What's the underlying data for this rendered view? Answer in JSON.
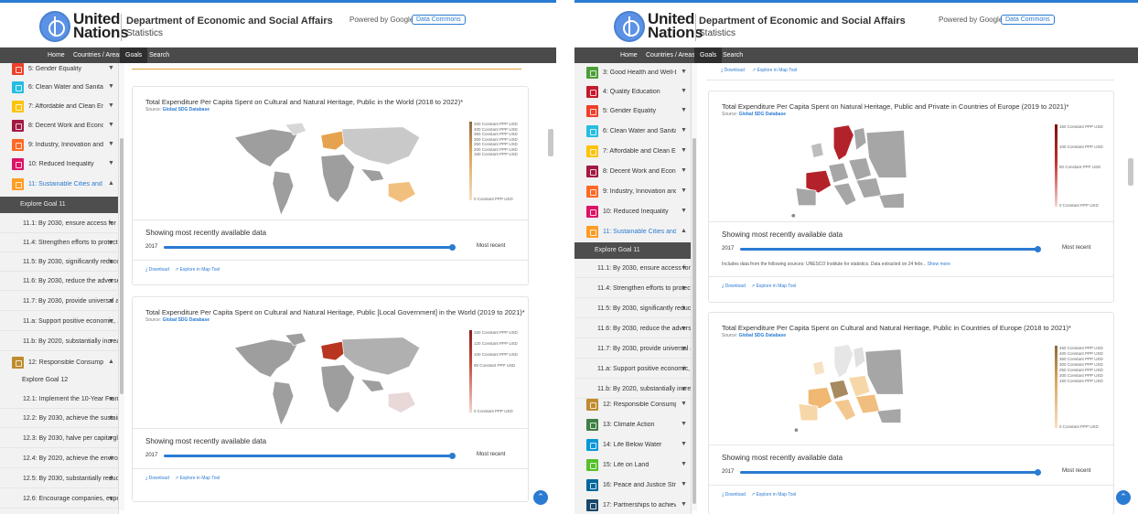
{
  "header": {
    "org_line1": "United",
    "org_line2": "Nations",
    "dept": "Department of Economic and Social Affairs",
    "subtitle": "Statistics",
    "powered": "Powered by Google's",
    "badge": "Data Commons"
  },
  "nav": {
    "home": "Home",
    "countries": "Countries / Areas",
    "goals": "Goals",
    "search": "Search"
  },
  "colors": {
    "accent": "#2a7bd2",
    "nav": "#4a4a4a",
    "map_high": "#b8361f",
    "map_low": "#f5e0c8"
  },
  "left": {
    "sidebar": {
      "goals": [
        {
          "label": "5: Gender Equality",
          "color": "#ef402b"
        },
        {
          "label": "6: Clean Water and Sanitation",
          "color": "#26bde2"
        },
        {
          "label": "7: Affordable and Clean Energy",
          "color": "#fcc30b"
        },
        {
          "label": "8: Decent Work and Economic ...",
          "color": "#a21942"
        },
        {
          "label": "9: Industry, Innovation and Infra...",
          "color": "#fd6925"
        },
        {
          "label": "10: Reduced Inequality",
          "color": "#dd1367"
        },
        {
          "label": "11: Sustainable Cities and Com...",
          "color": "#fd9d24"
        }
      ],
      "explore11": "Explore Goal 11",
      "targets11": [
        "11.1: By 2030, ensure access for a...",
        "11.4: Strengthen efforts to protect...",
        "11.5: By 2030, significantly reduce...",
        "11.6: By 2030, reduce the adverse...",
        "11.7: By 2030, provide universal a...",
        "11.a: Support positive economic, ...",
        "11.b: By 2020, substantially increa..."
      ],
      "goal12": {
        "label": "12: Responsible Consumption ...",
        "color": "#bf8b2e"
      },
      "explore12": "Explore Goal 12",
      "targets12": [
        "12.1: Implement the 10-Year Fram...",
        "12.2: By 2030, achieve the sustain...",
        "12.3: By 2030, halve per capita glo...",
        "12.4: By 2020, achieve the environ...",
        "12.5: By 2030, substantially reduc...",
        "12.6: Encourage companies, espe..."
      ]
    },
    "cards": [
      {
        "title": "Total Expenditure Per Capita Spent on Cultural and Natural Heritage, Public in the World (2018 to 2022)*",
        "source_label": "Source:",
        "source_link": "Global SDG Database",
        "legend": [
          "450 Constant PPP USD",
          "400 Constant PPP USD",
          "350 Constant PPP USD",
          "300 Constant PPP USD",
          "250 Constant PPP USD",
          "200 Constant PPP USD",
          "150 Constant PPP USD",
          "0 Constant PPP USD"
        ],
        "showing": "Showing most recently available data",
        "year": "2017",
        "recent": "Most recent",
        "download": "Download",
        "explore": "Explore in Map Tool"
      },
      {
        "title": "Total Expenditure Per Capita Spent on Cultural and Natural Heritage, Public [Local Government] in the World (2019 to 2021)*",
        "source_label": "Source:",
        "source_link": "Global SDG Database",
        "legend": [
          "150 Constant PPP USD",
          "120 Constant PPP USD",
          "100 Constant PPP USD",
          "80 Constant PPP USD",
          "0 Constant PPP USD"
        ],
        "showing": "Showing most recently available data",
        "year": "2017",
        "recent": "Most recent",
        "download": "Download",
        "explore": "Explore in Map Tool"
      }
    ]
  },
  "right": {
    "sidebar": {
      "goals_top": [
        {
          "label": "3: Good Health and Well-being",
          "color": "#4c9f38"
        },
        {
          "label": "4: Quality Education",
          "color": "#c5192d"
        },
        {
          "label": "5: Gender Equality",
          "color": "#ef402b"
        },
        {
          "label": "6: Clean Water and Sanitation",
          "color": "#26bde2"
        },
        {
          "label": "7: Affordable and Clean Energy",
          "color": "#fcc30b"
        },
        {
          "label": "8: Decent Work and Economic ...",
          "color": "#a21942"
        },
        {
          "label": "9: Industry, Innovation and Infra...",
          "color": "#fd6925"
        },
        {
          "label": "10: Reduced Inequality",
          "color": "#dd1367"
        },
        {
          "label": "11: Sustainable Cities and Com...",
          "color": "#fd9d24"
        }
      ],
      "explore11": "Explore Goal 11",
      "targets11": [
        "11.1: By 2030, ensure access for a...",
        "11.4: Strengthen efforts to protect...",
        "11.5: By 2030, significantly reduce...",
        "11.6: By 2030, reduce the adverse...",
        "11.7: By 2030, provide universal a...",
        "11.a: Support positive economic, ...",
        "11.b: By 2020, substantially increa..."
      ],
      "goals_bottom": [
        {
          "label": "12: Responsible Consumption ...",
          "color": "#bf8b2e"
        },
        {
          "label": "13: Climate Action",
          "color": "#3f7e44"
        },
        {
          "label": "14: Life Below Water",
          "color": "#0a97d9"
        },
        {
          "label": "15: Life on Land",
          "color": "#56c02b"
        },
        {
          "label": "16: Peace and Justice Strong In...",
          "color": "#00689d"
        },
        {
          "label": "17: Partnerships to achieve the ...",
          "color": "#19486a"
        }
      ]
    },
    "top_links": {
      "download": "Download",
      "explore": "Explore in Map Tool"
    },
    "cards": [
      {
        "title": "Total Expenditure Per Capita Spent on Natural Heritage, Public and Private in Countries of Europe (2019 to 2021)*",
        "source_label": "Source:",
        "source_link": "Global SDG Database",
        "legend": [
          "150 Constant PPP USD",
          "100 Constant PPP USD",
          "50 Constant PPP USD",
          "0 Constant PPP USD"
        ],
        "showing": "Showing most recently available data",
        "year": "2017",
        "recent": "Most recent",
        "includes": "Includes data from the following sources: UNESCO Institute for statistics. Data extracted on 24 febr...",
        "show_more": "Show more",
        "download": "Download",
        "explore": "Explore in Map Tool"
      },
      {
        "title": "Total Expenditure Per Capita Spent on Cultural and Natural Heritage, Public in Countries of Europe (2018 to 2021)*",
        "source_label": "Source:",
        "source_link": "Global SDG Database",
        "legend": [
          "450 Constant PPP USD",
          "400 Constant PPP USD",
          "350 Constant PPP USD",
          "300 Constant PPP USD",
          "250 Constant PPP USD",
          "200 Constant PPP USD",
          "150 Constant PPP USD",
          "0 Constant PPP USD"
        ],
        "showing": "Showing most recently available data",
        "year": "2017",
        "recent": "Most recent",
        "download": "Download",
        "explore": "Explore in Map Tool"
      }
    ]
  }
}
